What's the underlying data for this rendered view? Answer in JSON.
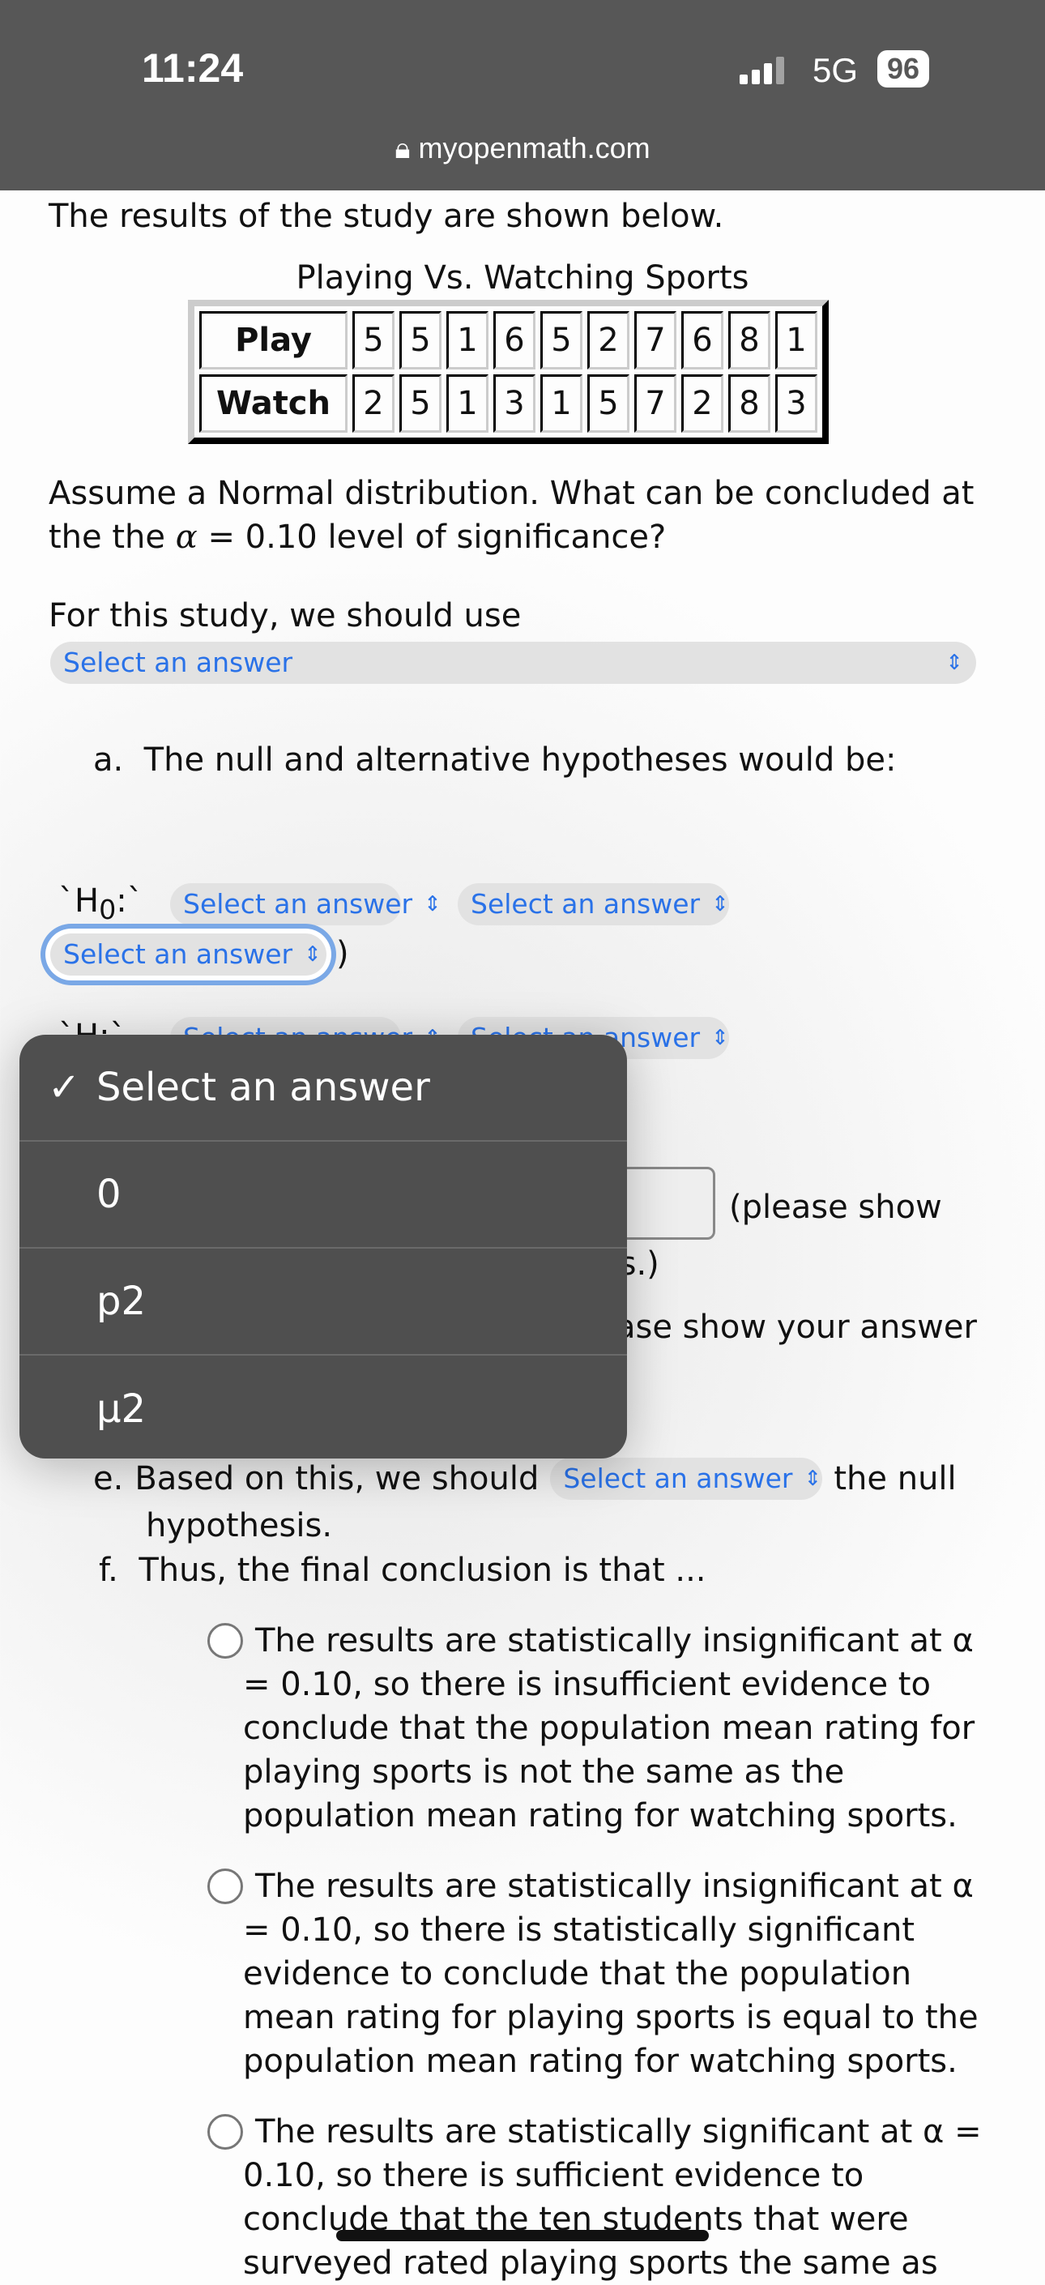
{
  "status_bar": {
    "time": "11:24",
    "network": "5G",
    "battery": "96",
    "url": "myopenmath.com"
  },
  "intro": "The results of the study are shown below.",
  "table": {
    "title": "Playing Vs. Watching Sports",
    "rows": [
      {
        "label": "Play",
        "values": [
          "5",
          "5",
          "1",
          "6",
          "5",
          "2",
          "7",
          "6",
          "8",
          "1"
        ]
      },
      {
        "label": "Watch",
        "values": [
          "2",
          "5",
          "1",
          "3",
          "1",
          "5",
          "7",
          "2",
          "8",
          "3"
        ]
      }
    ]
  },
  "question": {
    "line1": "Assume a Normal distribution.  What can be concluded at",
    "line2_pre": "the the ",
    "alpha": "α",
    "line2_post": " = 0.10 level of significance?"
  },
  "use_label": "For this study, we should use",
  "select_placeholder": "Select an answer",
  "part_a": {
    "marker": "a.",
    "text": "The null and alternative hypotheses would be:"
  },
  "h0_label": "`H",
  "h0_sub": "0",
  "h0_colon": ":`",
  "h1_label": "`H",
  "h1_colon": ":`",
  "paren": ")",
  "dropdown": {
    "items": [
      {
        "label": "Select an answer",
        "checked": true
      },
      {
        "label": "0"
      },
      {
        "label": "p2"
      },
      {
        "label": "μ2"
      }
    ]
  },
  "part_c_tail": "(please show",
  "part_c_tail2": "es.)",
  "part_d_tail": "ase show your answer",
  "part_e": {
    "marker": "e.",
    "pre": "Based on this, we should",
    "post": "the null",
    "line2": "hypothesis."
  },
  "part_f": {
    "marker": "f.",
    "text": "Thus, the final conclusion is that ..."
  },
  "options": [
    "The results are statistically insignificant at α = 0.10, so there is insufficient evidence to conclude that the population mean rating for playing sports is not the same as the population mean rating for watching sports.",
    "The results are statistically insignificant at α = 0.10, so there is statistically significant evidence to conclude that the population mean rating for playing sports is equal to the population mean rating for watching sports.",
    "The results are statistically significant at α = 0.10, so there is sufficient evidence to conclude that the ten students that were surveyed rated playing sports the same as"
  ],
  "colors": {
    "link": "#2a72e8",
    "status_bar": "#575757",
    "menu": "#4f4f4f",
    "focus": "#7aa8e6"
  }
}
